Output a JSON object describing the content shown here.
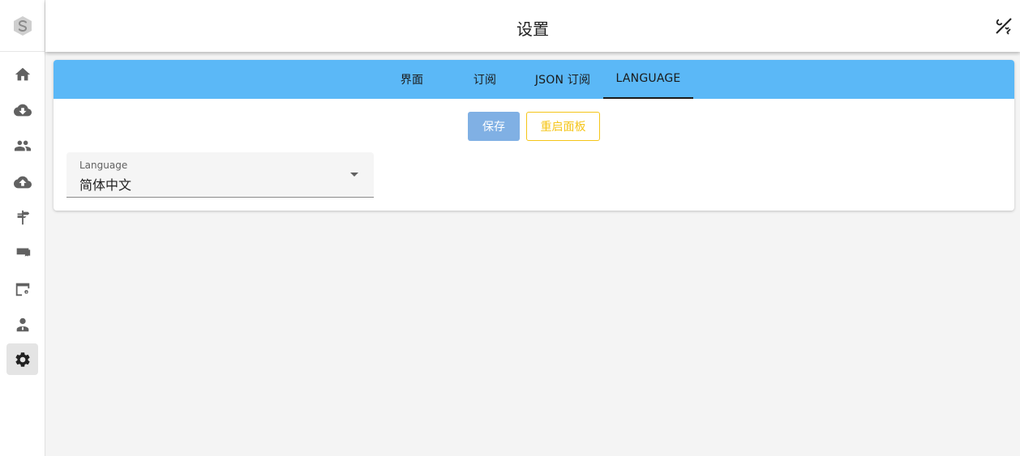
{
  "header": {
    "title": "设置"
  },
  "tabs": [
    {
      "label": "界面"
    },
    {
      "label": "订阅"
    },
    {
      "label": "JSON 订阅"
    },
    {
      "label": "LANGUAGE"
    }
  ],
  "actions": {
    "save_label": "保存",
    "restart_label": "重启面板"
  },
  "language_select": {
    "label": "Language",
    "value": "简体中文"
  },
  "sidebar": {
    "items": [
      {
        "icon": "home-icon"
      },
      {
        "icon": "cloud-download-icon"
      },
      {
        "icon": "users-icon"
      },
      {
        "icon": "cloud-upload-icon"
      },
      {
        "icon": "signpost-icon"
      },
      {
        "icon": "certificate-icon"
      },
      {
        "icon": "web-settings-icon"
      },
      {
        "icon": "admin-icon"
      },
      {
        "icon": "settings-gear-icon",
        "active": true
      }
    ]
  },
  "colors": {
    "tab_bar": "#5bb8f7",
    "save_button": "#80b0e4",
    "restart_button": "#f5c518"
  }
}
